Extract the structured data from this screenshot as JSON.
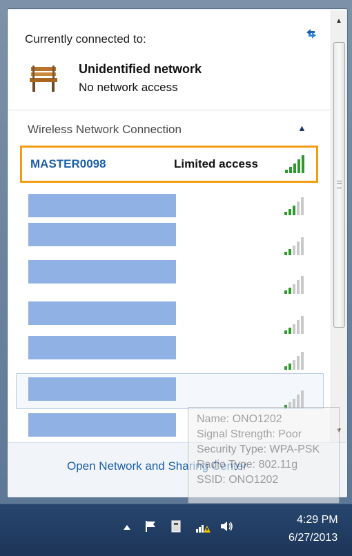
{
  "header": {
    "connected_label": "Currently connected to:",
    "network_name": "Unidentified network",
    "network_status": "No network access"
  },
  "section": {
    "title": "Wireless Network Connection"
  },
  "selected_network": {
    "ssid": "MASTER0098",
    "status": "Limited access"
  },
  "networks": [
    {
      "ssid_redacted": true
    },
    {
      "ssid_redacted": true
    },
    {
      "ssid_redacted": true
    },
    {
      "ssid_redacted": true
    },
    {
      "ssid_redacted": true
    },
    {
      "ssid_redacted": true
    },
    {
      "ssid_redacted": true
    }
  ],
  "footer": {
    "link": "Open Network and Sharing Center"
  },
  "tooltip": {
    "name": "Name: ONO1202",
    "signal": "Signal Strength: Poor",
    "security": "Security Type: WPA-PSK",
    "radio": "Radio Type: 802.11g",
    "ssid": "SSID: ONO1202"
  },
  "taskbar": {
    "time": "4:29 PM",
    "date": "6/27/2013"
  },
  "colors": {
    "link": "#1b5ea8",
    "selection_border": "#f39c12",
    "redaction": "#8fb1e3",
    "signal_green": "#2e9a2e"
  }
}
